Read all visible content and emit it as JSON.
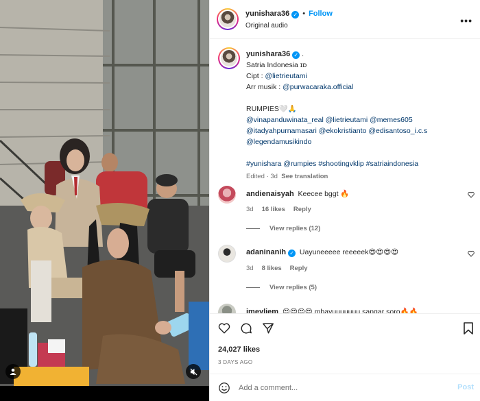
{
  "header": {
    "username": "yunishara36",
    "dot": "•",
    "follow_label": "Follow",
    "subtitle": "Original audio",
    "more_label": "•••"
  },
  "caption": {
    "username": "yunishara36",
    "after_name": ".",
    "line1": "Satria Indonesia ɪᴅ",
    "cipt_label": "Cipt :",
    "cipt_handle": "@lietrieutami",
    "arr_label": "Arr musik :",
    "arr_handle": "@purwacaraka.official",
    "rumpies": "RUMPIES🤍🙏",
    "mentions1": "@vinapanduwinata_real @lietrieutami @memes605",
    "mentions2": "@itadyahpurnamasari @ekokristianto @edisantoso_i.c.s",
    "mentions3": "@legendamusikindo",
    "hashtags": "#yunishara @rumpies #shootingvklip #satriaindonesia",
    "edited": "Edited · 3d",
    "see_translation": "See translation"
  },
  "comments": [
    {
      "username": "andienaisyah",
      "text": "Keecee bggt 🔥",
      "time": "3d",
      "likes": "16 likes",
      "reply": "Reply",
      "view_replies": "View replies (12)"
    },
    {
      "username": "adaninanih",
      "text": "Uayuneeeee reeeeek😍😍😍😍",
      "time": "3d",
      "likes": "8 likes",
      "reply": "Reply",
      "view_replies": "View replies (5)"
    },
    {
      "username": "imeyliem",
      "text": "😍😍😍😍 mbayuuuuuuu sangar soro🔥🔥"
    }
  ],
  "actions": {
    "likes": "24,027 likes",
    "date": "3 DAYS AGO"
  },
  "add_comment": {
    "placeholder": "Add a comment...",
    "post_label": "Post"
  },
  "colors": {
    "accent": "#0095f6",
    "link": "#00376b",
    "muted": "#737373"
  }
}
